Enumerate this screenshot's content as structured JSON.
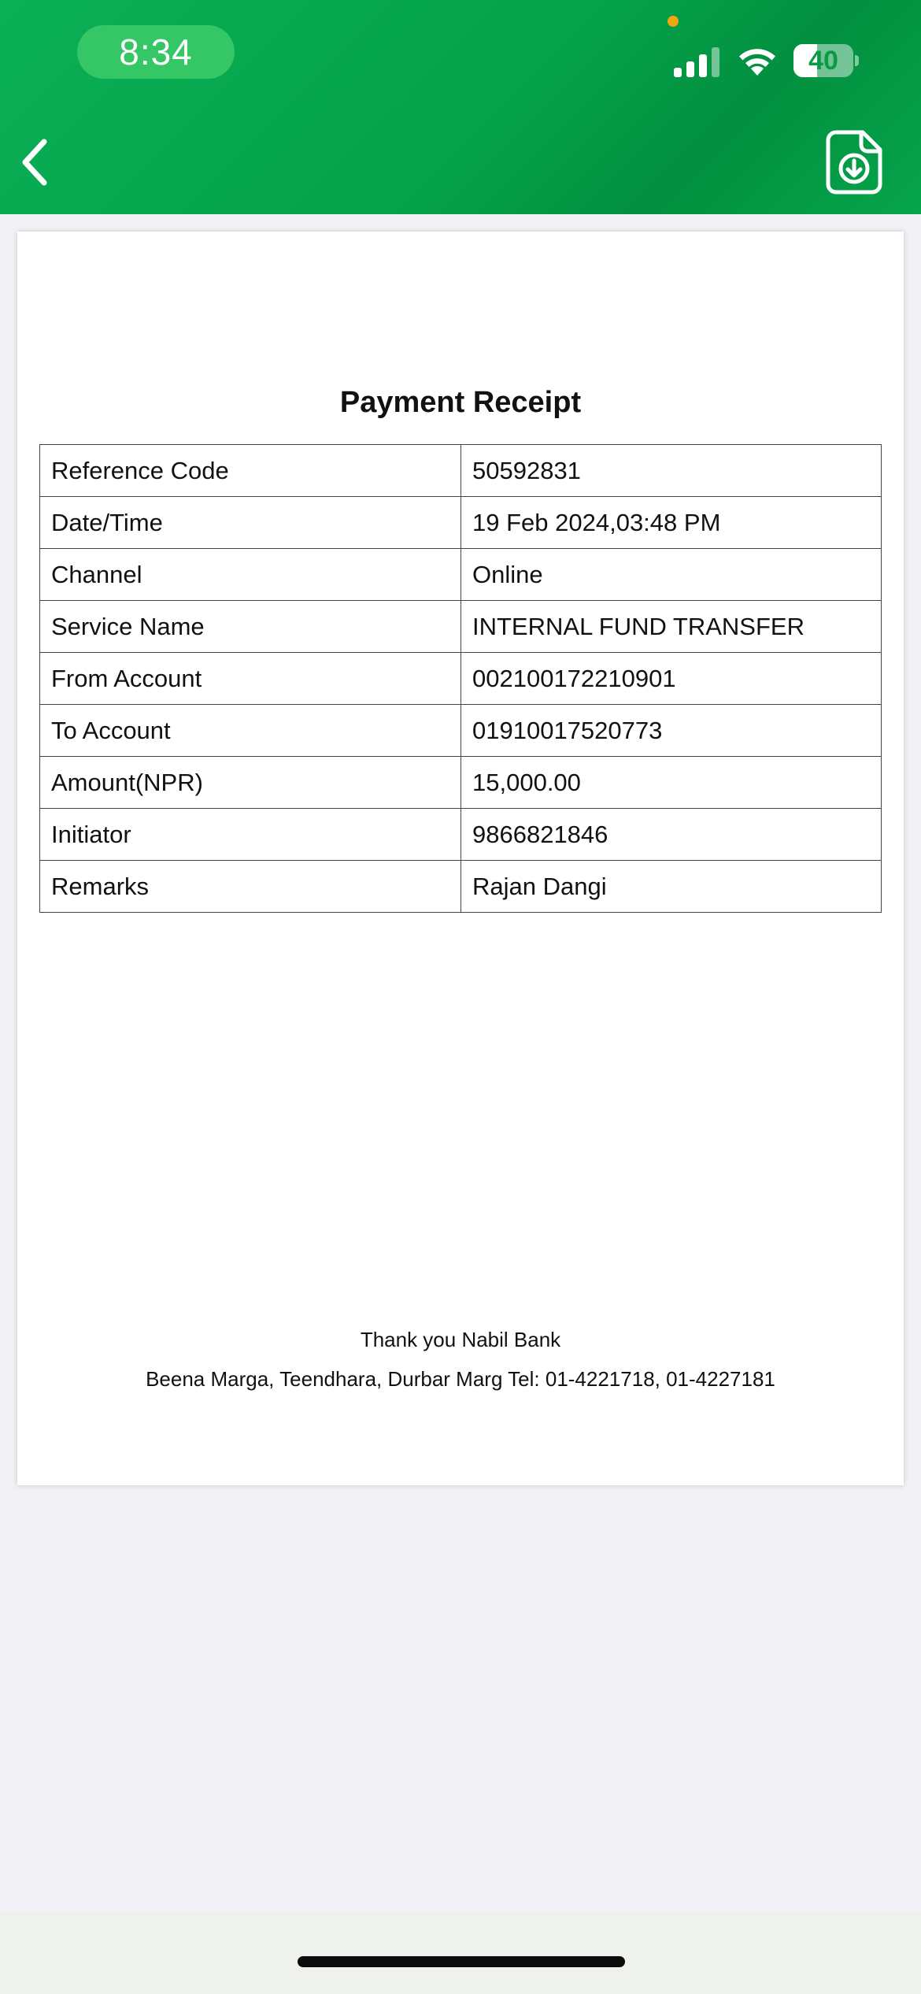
{
  "status_bar": {
    "time": "8:34",
    "battery_level": "40",
    "battery_fraction": 0.4,
    "signal_bars": 3
  },
  "nav": {
    "back_icon": "chevron-left-icon",
    "download_icon": "file-download-icon"
  },
  "colors": {
    "header_green": "#04a14a",
    "card_bg": "#ffffff",
    "page_bg": "#f1f1f6"
  },
  "receipt": {
    "title": "Payment Receipt",
    "rows": [
      {
        "label": "Reference Code",
        "value": "50592831"
      },
      {
        "label": "Date/Time",
        "value": "19 Feb 2024,03:48 PM"
      },
      {
        "label": "Channel",
        "value": "Online"
      },
      {
        "label": "Service Name",
        "value": "INTERNAL FUND TRANSFER"
      },
      {
        "label": "From Account",
        "value": "002100172210901"
      },
      {
        "label": "To Account",
        "value": "01910017520773"
      },
      {
        "label": "Amount(NPR)",
        "value": "15,000.00"
      },
      {
        "label": "Initiator",
        "value": "9866821846"
      },
      {
        "label": "Remarks",
        "value": "Rajan Dangi"
      }
    ],
    "footer_thanks": "Thank you Nabil Bank",
    "footer_address": "Beena Marga, Teendhara, Durbar Marg Tel: 01-4221718, 01-4227181"
  }
}
